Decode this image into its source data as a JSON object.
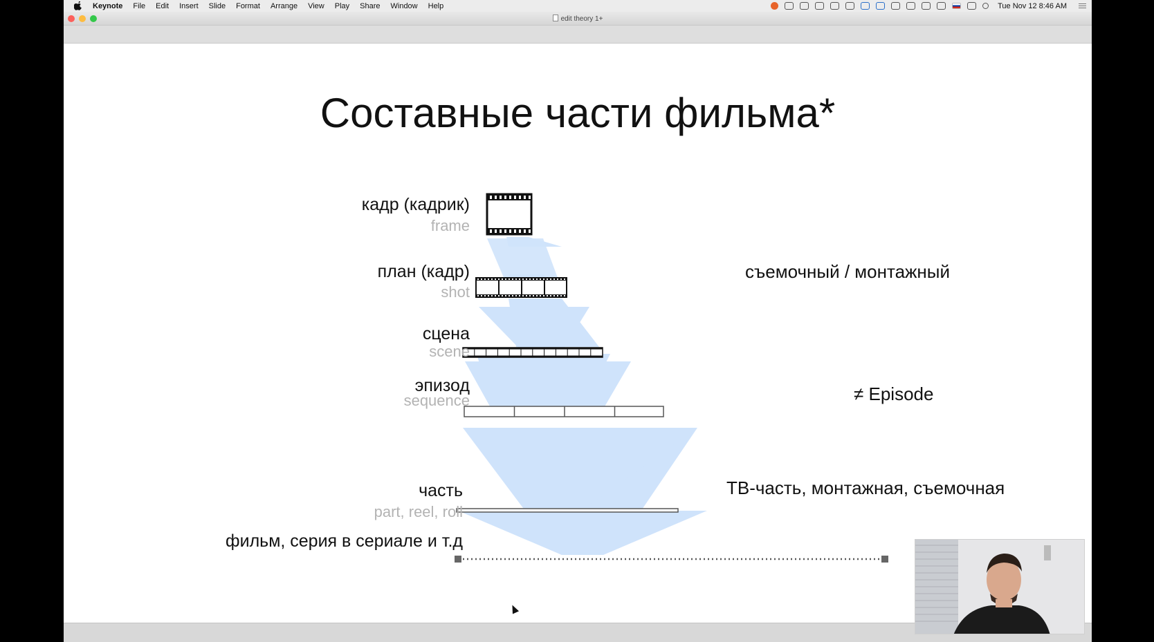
{
  "menubar": {
    "items": [
      {
        "label": "Keynote",
        "name": "menu-keynote",
        "app": true
      },
      {
        "label": "File",
        "name": "menu-file"
      },
      {
        "label": "Edit",
        "name": "menu-edit"
      },
      {
        "label": "Insert",
        "name": "menu-insert"
      },
      {
        "label": "Slide",
        "name": "menu-slide"
      },
      {
        "label": "Format",
        "name": "menu-format"
      },
      {
        "label": "Arrange",
        "name": "menu-arrange"
      },
      {
        "label": "View",
        "name": "menu-view"
      },
      {
        "label": "Play",
        "name": "menu-play"
      },
      {
        "label": "Share",
        "name": "menu-share"
      },
      {
        "label": "Window",
        "name": "menu-window"
      },
      {
        "label": "Help",
        "name": "menu-help"
      }
    ],
    "status_icons": [
      {
        "name": "record-icon",
        "color": "#e8642a"
      },
      {
        "name": "adobe-icon",
        "color": "#555555"
      },
      {
        "name": "sync-icon",
        "color": "#555555"
      },
      {
        "name": "dropbox-icon",
        "color": "#555555"
      },
      {
        "name": "drive-icon",
        "color": "#555555"
      },
      {
        "name": "globe-icon",
        "color": "#555555"
      },
      {
        "name": "teamviewer-icon",
        "color": "#2a6fc9"
      },
      {
        "name": "sync-circle-icon",
        "color": "#2a6fc9"
      },
      {
        "name": "display-icon",
        "color": "#555555"
      },
      {
        "name": "cloud-icon",
        "color": "#555555"
      },
      {
        "name": "time-machine-icon",
        "color": "#555555"
      },
      {
        "name": "wifi-icon",
        "color": "#555555"
      },
      {
        "name": "russian-flag-icon",
        "color": "#d52b1e"
      },
      {
        "name": "volume-icon",
        "color": "#555555"
      },
      {
        "name": "spotlight-search-icon",
        "color": "#555555"
      }
    ],
    "clock": "Tue Nov 12  8:46 AM"
  },
  "window": {
    "title": "edit theory 1+"
  },
  "slide": {
    "title": "Составные части фильма*",
    "levels": [
      {
        "ru": "кадр (кадрик)",
        "en": "frame"
      },
      {
        "ru": "план (кадр)",
        "en": "shot"
      },
      {
        "ru": "сцена",
        "en": "scene"
      },
      {
        "ru": "эпизод",
        "en": "sequence"
      },
      {
        "ru": "часть",
        "en": "part, reel, roll"
      },
      {
        "ru": "фильм, серия в сериале и т.д",
        "en": ""
      }
    ],
    "notes": {
      "shot": "съемочный / монтажный",
      "sequence": "≠ Episode",
      "part": "ТВ-часть, монтажная, съемочная"
    }
  },
  "colors": {
    "cone": "#cfe3fb",
    "film": "#111111",
    "subtitle": "#b3b3b3"
  }
}
